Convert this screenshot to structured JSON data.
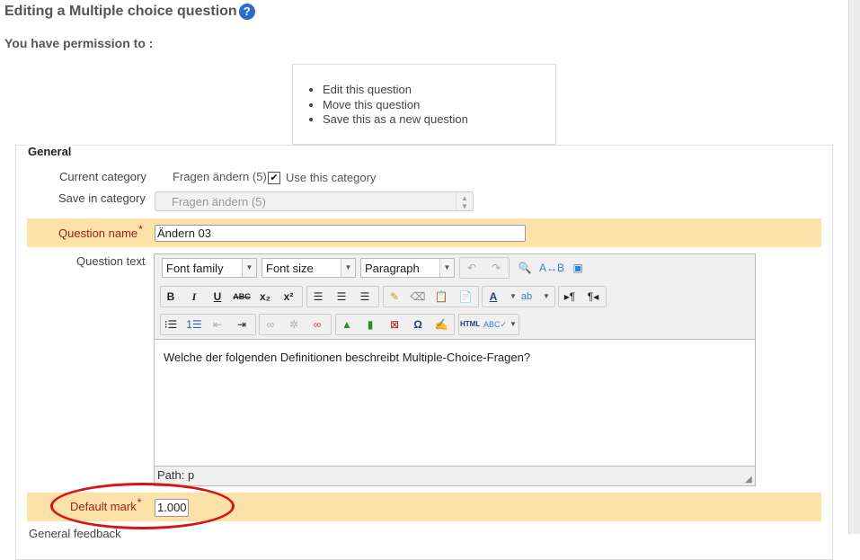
{
  "page": {
    "title": "Editing a Multiple choice question",
    "help_icon": "help-icon"
  },
  "permissions": {
    "heading": "You have permission to :",
    "items": [
      "Edit this question",
      "Move this question",
      "Save this as a new question"
    ]
  },
  "general": {
    "legend": "General",
    "current_category": {
      "label": "Current category",
      "value": "Fragen ändern (5)",
      "checkbox_checked": true,
      "checkbox_label": "Use this category"
    },
    "save_in_category": {
      "label": "Save in category",
      "value": "Fragen ändern (5)",
      "disabled": true
    },
    "question_name": {
      "label": "Question name",
      "required": "*",
      "value": "Ändern 03"
    },
    "question_text": {
      "label": "Question text",
      "toolbar": {
        "font_family": "Font family",
        "font_size": "Font size",
        "format": "Paragraph",
        "icons": [
          "undo-icon",
          "redo-icon",
          "find-icon",
          "replace-icon",
          "fullscreen-icon",
          "bold-icon",
          "italic-icon",
          "underline-icon",
          "strikethrough-icon",
          "subscript-icon",
          "superscript-icon",
          "align-left-icon",
          "align-center-icon",
          "align-right-icon",
          "cleanup-icon",
          "eraser-icon",
          "paste-text-icon",
          "paste-word-icon",
          "text-color-icon",
          "highlight-color-icon",
          "ltr-icon",
          "rtl-icon",
          "bullet-list-icon",
          "numbered-list-icon",
          "outdent-icon",
          "indent-icon",
          "link-icon",
          "unlink-icon",
          "nolink-icon",
          "image-icon",
          "media-icon",
          "moodle-media-icon",
          "special-char-icon",
          "edit-icon",
          "html-icon",
          "spellcheck-icon"
        ]
      },
      "content": "Welche der folgenden Definitionen beschreibt Multiple-Choice-Fragen?",
      "path": "Path: p"
    },
    "default_mark": {
      "label": "Default mark",
      "required": "*",
      "value": "1.000"
    },
    "next_label_partial": "General feedback"
  },
  "colors": {
    "required_row": "#fce2a8",
    "annotation": "#d91414",
    "required_label": "#a01e1e"
  }
}
